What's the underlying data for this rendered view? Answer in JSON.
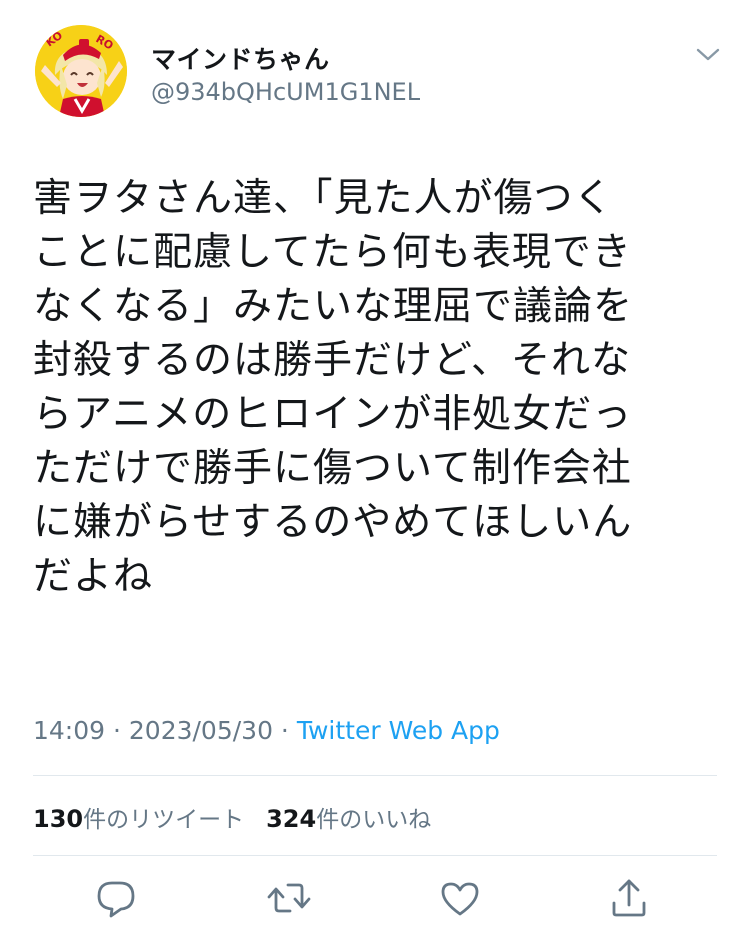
{
  "header": {
    "display_name": "マインドちゃん",
    "handle": "@934bQHcUM1G1NEL",
    "avatar_badge": "KOKORO"
  },
  "tweet": {
    "lines": [
      "害ヲタさん達、「見た人が傷つく",
      "ことに配慮してたら何も表現でき",
      "なくなる」みたいな理屈で議論を",
      "封殺するのは勝手だけど、それな",
      "らアニメのヒロインが非処女だっ",
      "ただけで勝手に傷ついて制作会社",
      "に嫌がらせするのやめてほしいん",
      "だよね"
    ],
    "time": "14:09",
    "date": "2023/05/30",
    "separator": " · ",
    "source": "Twitter Web App"
  },
  "stats": {
    "retweet_count": "130",
    "retweet_label": "件のリツイート",
    "like_count": "324",
    "like_label": "件のいいね"
  },
  "actions": [
    {
      "name": "reply",
      "icon": "speech-bubble-icon"
    },
    {
      "name": "retweet",
      "icon": "retweet-arrows-icon"
    },
    {
      "name": "like",
      "icon": "heart-icon"
    },
    {
      "name": "share",
      "icon": "share-upload-icon"
    }
  ],
  "colors": {
    "text": "#14171a",
    "secondary": "#657786",
    "link": "#1da1f2",
    "divider": "#e1e8ed",
    "avatar_background": "#f7d117"
  }
}
